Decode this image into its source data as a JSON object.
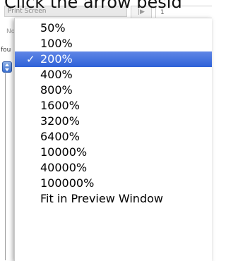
{
  "caption": "Click the arrow besid",
  "background": {
    "field_text": "Print Screen",
    "play_glyph": "|▶",
    "ruler_tick": "1",
    "label_no": "No",
    "label_fou": "fou"
  },
  "zoom_menu": {
    "items": [
      {
        "label": "50%",
        "selected": false
      },
      {
        "label": "100%",
        "selected": false
      },
      {
        "label": "200%",
        "selected": true
      },
      {
        "label": "400%",
        "selected": false
      },
      {
        "label": "800%",
        "selected": false
      },
      {
        "label": "1600%",
        "selected": false
      },
      {
        "label": "3200%",
        "selected": false
      },
      {
        "label": "6400%",
        "selected": false
      },
      {
        "label": "10000%",
        "selected": false
      },
      {
        "label": "40000%",
        "selected": false
      },
      {
        "label": "100000%",
        "selected": false
      },
      {
        "label": "Fit in Preview Window",
        "selected": false
      }
    ],
    "check_glyph": "✓",
    "selected_color": "#3A6CDA"
  }
}
